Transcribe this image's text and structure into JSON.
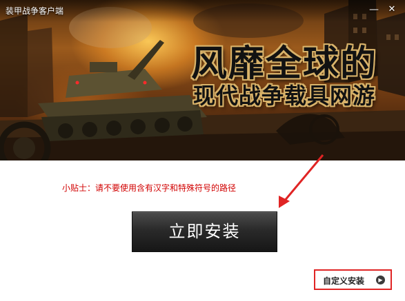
{
  "window": {
    "title": "装甲战争客户端",
    "minimize_icon": "minimize-icon",
    "close_icon": "close-icon"
  },
  "banner": {
    "slogan_line1": "风靡全球的",
    "slogan_line2": "现代战争载具网游",
    "image_subject": "tank-battlefield"
  },
  "main": {
    "tip_text": "小贴士：请不要使用含有汉字和特殊符号的路径",
    "install_button_label": "立即安装",
    "custom_install_label": "自定义安装",
    "custom_install_icon": "chevron-right-circle-icon"
  },
  "colors": {
    "tip": "#d10000",
    "annotation": "#e02424",
    "button": "#1f1f1f"
  }
}
